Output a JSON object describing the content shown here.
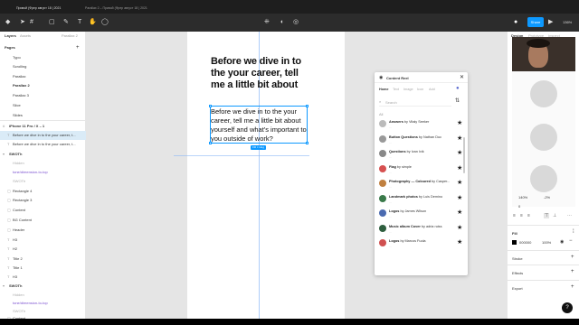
{
  "topbar": {
    "tabs": [
      "Привой (Фрер август 18 | 2021",
      "Parallax 2 – Привой (Фрер август 18 | 2021"
    ],
    "share_label": "Share",
    "zoom": "136%",
    "colors": {
      "bg": "#2c2c2c",
      "share": "#0d99ff"
    }
  },
  "left": {
    "tabs": [
      "Layers",
      "Assets",
      "Parallax 2"
    ],
    "pages_label": "Pages",
    "pages": [
      "Typo",
      "Scrolling",
      "Parallax",
      "Parallax 2",
      "Parallax 3",
      "Slice",
      "Slides"
    ],
    "frame_label": "iPhone 11 Pro / X – 1",
    "layers_top": [
      "Before we dive in to the your career, t...",
      "Before we dive in to the your career, t..."
    ],
    "group1": "SWOTh",
    "group1_items": [
      "Hidden",
      "tone/dimension-to-top",
      "SWOTh",
      "Rectangle 4",
      "Rectangle 3",
      "Content",
      "BG Content",
      "Header",
      "H3",
      "H2",
      "Title 2",
      "Title 1",
      "H3"
    ],
    "group2": "SWOTh",
    "group2_items": [
      "Hidden",
      "tone/dimension-to-top",
      "SWOTh",
      "Content"
    ]
  },
  "canvas": {
    "title": "Before we dive in to the your career, tell me a little bit about",
    "body": "Before we dive in to the your career, tell me a little bit about yourself and what's important to you outside of work?",
    "dimension_badge": "Fill × Hug"
  },
  "plugin": {
    "title": "Content Reel",
    "tabs": [
      "Home",
      "Text",
      "Image",
      "Icon",
      "Add"
    ],
    "search_placeholder": "Search",
    "section": "All",
    "items": [
      {
        "name": "Answers",
        "by": "by Vitaly Seeker",
        "color": "#bbbbbb"
      },
      {
        "name": "Button Questions",
        "by": "by Nathan Duc",
        "color": "#999999"
      },
      {
        "name": "Questions",
        "by": "by Ivan Ivik",
        "color": "#888888"
      },
      {
        "name": "Flag",
        "by": "by simple",
        "color": "#d65050"
      },
      {
        "name": "Photography — Coloured",
        "by": "by Casper...",
        "color": "#c08040"
      },
      {
        "name": "Landmark photos",
        "by": "by Luis Demino",
        "color": "#3a7a4a"
      },
      {
        "name": "Logos",
        "by": "by James Wilson",
        "color": "#4a6ab0"
      },
      {
        "name": "Music album Cover",
        "by": "by adria ruiss",
        "color": "#2f5f3f"
      },
      {
        "name": "Logos",
        "by": "by Marcos Fuola",
        "color": "#d05050"
      }
    ]
  },
  "right": {
    "tabs": [
      "Design",
      "Prototype",
      "Inspect"
    ],
    "line_height": "140%",
    "letter_spacing": "-2%",
    "paragraph": "0",
    "fill_label": "Fill",
    "fill_hex": "000000",
    "fill_opacity": "100%",
    "stroke_label": "Stroke",
    "effects_label": "Effects",
    "export_label": "Export"
  }
}
